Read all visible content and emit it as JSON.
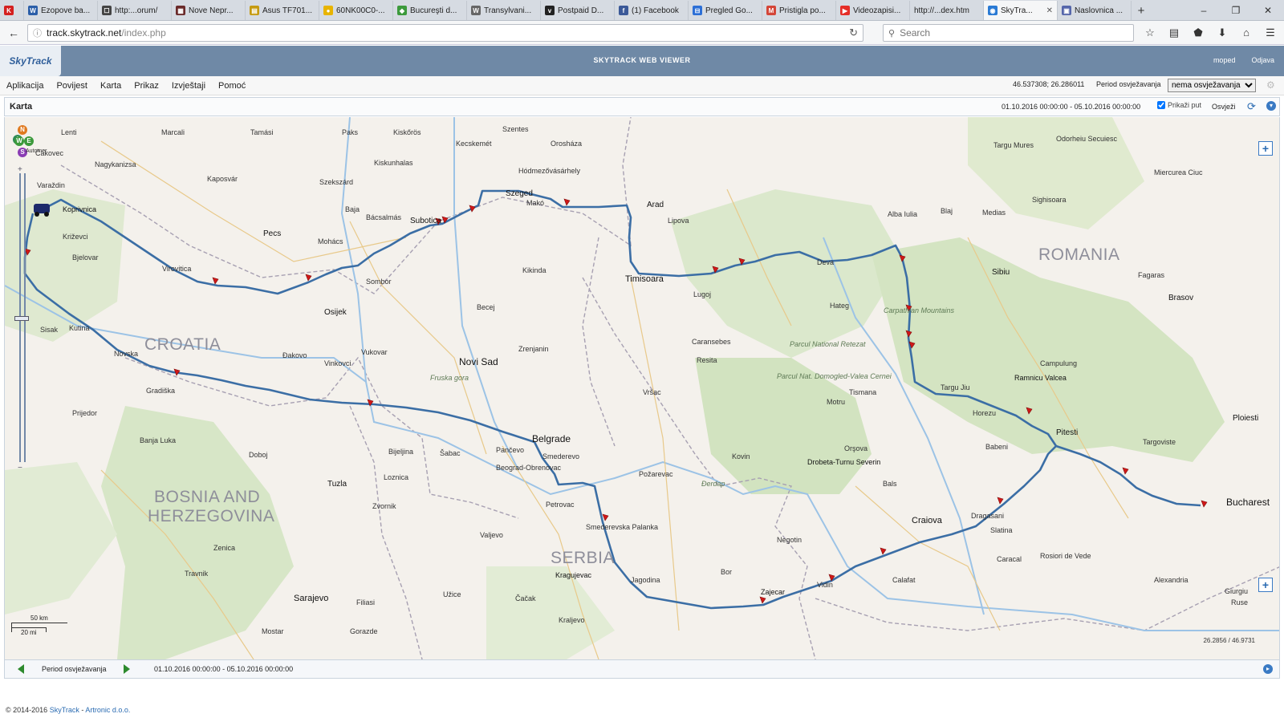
{
  "browser": {
    "tabs": [
      {
        "label": "",
        "icon": "k-icon",
        "color": "#d42020",
        "glyph": "K"
      },
      {
        "label": "Ezopove ba...",
        "icon": "forum-icon",
        "color": "#2b5ea8",
        "glyph": "W"
      },
      {
        "label": "http:...orum/",
        "icon": "forum-icon",
        "color": "#444",
        "glyph": "☐"
      },
      {
        "label": "Nove Nepr...",
        "icon": "film-icon",
        "color": "#6a2a2a",
        "glyph": "▦"
      },
      {
        "label": "Asus TF701...",
        "icon": "shop-icon",
        "color": "#c59a10",
        "glyph": "▤"
      },
      {
        "label": "60NK00C0-...",
        "icon": "bulb-icon",
        "color": "#e8b400",
        "glyph": "●"
      },
      {
        "label": "Bucureşti d...",
        "icon": "maps-icon",
        "color": "#3c9a3c",
        "glyph": "◆"
      },
      {
        "label": "Transylvani...",
        "icon": "wikipedia-icon",
        "color": "#666",
        "glyph": "W"
      },
      {
        "label": "Postpaid D...",
        "icon": "vip-icon",
        "color": "#222",
        "glyph": "v"
      },
      {
        "label": "(1) Facebook",
        "icon": "facebook-icon",
        "color": "#3b5998",
        "glyph": "f"
      },
      {
        "label": "Pregled Go...",
        "icon": "doc-icon",
        "color": "#2c6fd6",
        "glyph": "⊟"
      },
      {
        "label": "Pristigla po...",
        "icon": "gmail-icon",
        "color": "#d44638",
        "glyph": "M"
      },
      {
        "label": "Videozapisi...",
        "icon": "youtube-icon",
        "color": "#e52d27",
        "glyph": "▶"
      },
      {
        "label": "http://...dex.htm",
        "icon": "page-icon",
        "color": "#999",
        "glyph": ""
      },
      {
        "label": "SkyTra...",
        "icon": "globe-icon",
        "color": "#2a7ad4",
        "glyph": "◉",
        "active": true
      },
      {
        "label": "Naslovnica ...",
        "icon": "news-icon",
        "color": "#5566aa",
        "glyph": "▣"
      }
    ],
    "new_tab": "+",
    "window_controls": [
      "–",
      "❐",
      "✕"
    ],
    "url_host": "track.skytrack.net",
    "url_path": "/index.php",
    "search_placeholder": "Search",
    "toolbar_icons": [
      "☆",
      "▤",
      "⬟",
      "⬇",
      "⌂",
      "☰"
    ]
  },
  "app": {
    "logo": "SkyTrack",
    "title": "SKYTRACK WEB VIEWER",
    "user": "moped",
    "logout": "Odjava"
  },
  "menu": {
    "items": [
      "Aplikacija",
      "Povijest",
      "Karta",
      "Prikaz",
      "Izvještaji",
      "Pomoć"
    ],
    "coords": "46.537308; 26.286011",
    "period_label": "Period osvježavanja",
    "period_value": "nema osvježavanja",
    "gear": "⚙"
  },
  "panel": {
    "title": "Karta",
    "date_range": "01.10.2016 00:00:00 - 05.10.2016 00:00:00",
    "show_path": "Prikaži put",
    "refresh": "Osvježi"
  },
  "map": {
    "compass": [
      "N",
      "A",
      "W",
      "E",
      "S"
    ],
    "compass_side": "Automer",
    "zoom_top": "+",
    "zoom_bottom": "−",
    "scale_km": "50 km",
    "scale_mi": "20 mi",
    "coords_readout": "26.2856 / 46.9731",
    "corner_plus": "+",
    "countries": [
      {
        "name": "CROATIA"
      },
      {
        "name": "ROMANIA"
      },
      {
        "name": "BOSNIA AND"
      },
      {
        "name": "HERZEGOVINA"
      },
      {
        "name": "SERBIA"
      }
    ],
    "cities": [
      {
        "name": "Belgrade"
      },
      {
        "name": "Novi Sad"
      },
      {
        "name": "Bucharest"
      },
      {
        "name": "Timisoara"
      },
      {
        "name": "Craiova"
      },
      {
        "name": "Sarajevo"
      },
      {
        "name": "Szeged"
      },
      {
        "name": "Osijek"
      },
      {
        "name": "Pitesti"
      },
      {
        "name": "Brasov"
      },
      {
        "name": "Tuzla"
      },
      {
        "name": "Arad"
      },
      {
        "name": "Subotica"
      },
      {
        "name": "Pecs"
      },
      {
        "name": "Sibiu"
      },
      {
        "name": "Ploiesti"
      },
      {
        "name": "Koprivnica"
      },
      {
        "name": "Ramnicu Valcea"
      },
      {
        "name": "Drobeta-Turnu Severin"
      },
      {
        "name": "Zajecar"
      },
      {
        "name": "Kragujevac"
      }
    ],
    "towns": [
      "Lenti",
      "Marcali",
      "Tamási",
      "Paks",
      "Kiskőrös",
      "Kecskemét",
      "Szentes",
      "Orosháza",
      "Nagykanizsa",
      "Kaposvár",
      "Szekszárd",
      "Baja",
      "Mohács",
      "Bácsalmás",
      "Kiskunhalas",
      "Hódmezővásárhely",
      "Makó",
      "Lipova",
      "Deva",
      "Hateg",
      "Lugoj",
      "Resita",
      "Caransebes",
      "Vršac",
      "Zrenjanin",
      "Kikinda",
      "Becej",
      "Sombor",
      "Vukovar",
      "Vinkovci",
      "Đakovo",
      "Virovitica",
      "Bjelovar",
      "Križevci",
      "Varaždin",
      "Čakovec",
      "Sisak",
      "Kutina",
      "Novska",
      "Gradiška",
      "Prijedor",
      "Banja Luka",
      "Doboj",
      "Zvornik",
      "Bijeljina",
      "Šabac",
      "Valjevo",
      "Čačak",
      "Kraljevo",
      "Jagodina",
      "Smederevo",
      "Požarevac",
      "Bor",
      "Negotin",
      "Vidin",
      "Calafat",
      "Caracal",
      "Slatina",
      "Rosiori de Vede",
      "Alexandria",
      "Giurgiu",
      "Ruse",
      "Targoviste",
      "Campulung",
      "Fagaras",
      "Sighisoara",
      "Medias",
      "Blaj",
      "Alba Iulia",
      "Targu Mures",
      "Odorheiu Secuiesc",
      "Miercurea Ciuc",
      "Zenica",
      "Travnik",
      "Mostar",
      "Gorazde",
      "Užice",
      "Loznica",
      "Pančevo",
      "Beograd-Obrenovac",
      "Smederevska Palanka",
      "Petrovac",
      "Kovin",
      "Orşova",
      "Motru",
      "Tismana",
      "Targu Jiu",
      "Horezu",
      "Babeni",
      "Dragasani",
      "Bals",
      "Filiasi"
    ],
    "regions": [
      "Carpathian Mountains",
      "Parcul National Retezat",
      "Parcul Nat. Domogled-Valea Cernei",
      "Fruska gora",
      "Đerdap"
    ]
  },
  "period_bar": {
    "label": "Period osvježavanja",
    "range": "01.10.2016 00:00:00 - 05.10.2016 00:00:00"
  },
  "footer": {
    "copy": "© 2014-2016 ",
    "brand": "SkyTrack",
    "sep": " - ",
    "company": "Artronic d.o.o."
  }
}
